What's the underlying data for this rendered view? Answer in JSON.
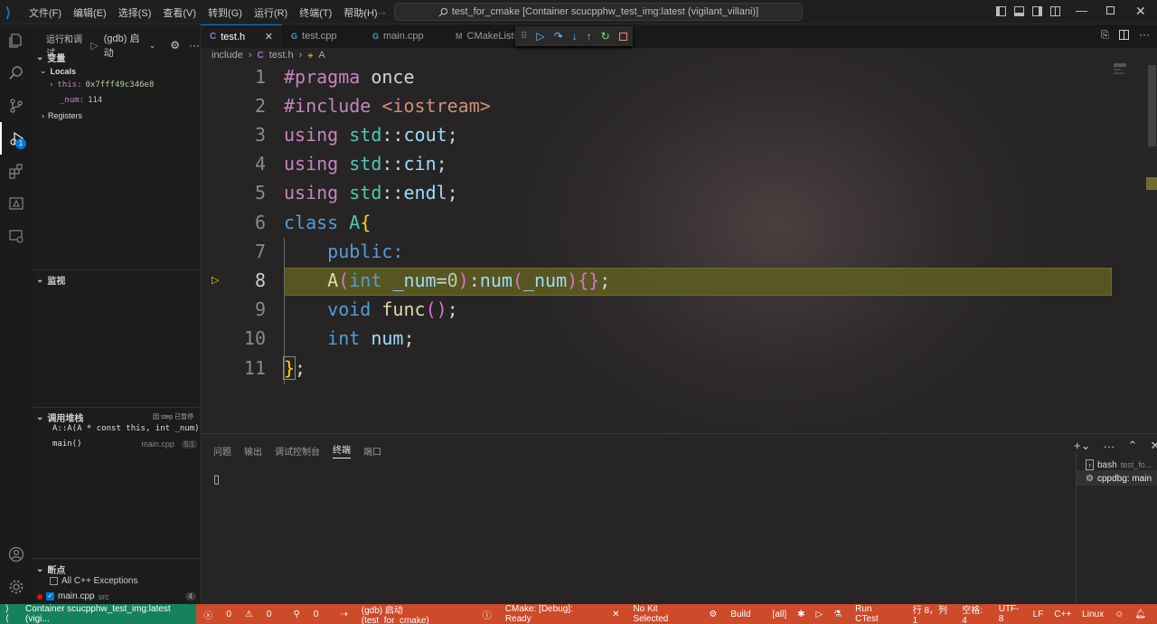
{
  "menu": [
    "文件(F)",
    "编辑(E)",
    "选择(S)",
    "查看(V)",
    "转到(G)",
    "运行(R)",
    "终端(T)",
    "帮助(H)"
  ],
  "command_center": "test_for_cmake [Container scucpphw_test_img:latest (vigilant_villani)]",
  "activity": {
    "debug_badge": "1"
  },
  "sidebar": {
    "run_title": "运行和调试",
    "config": "(gdb) 启动",
    "variables_title": "变量",
    "locals_label": "Locals",
    "var_this_name": "this:",
    "var_this_value": "0x7fff49c346e8",
    "var_num_name": "_num:",
    "var_num_value": "114",
    "registers_label": "Registers",
    "watch_title": "监视",
    "callstack_title": "调用堆栈",
    "callstack_status": "因 step 已暂停",
    "frames": [
      {
        "name": "A::A(A * const this, int _num)",
        "file": "",
        "pos": ""
      },
      {
        "name": "main()",
        "file": "main.cpp",
        "pos": "5:1"
      }
    ],
    "breakpoints_title": "断点",
    "bp1": "All C++ Exceptions",
    "bp2": "main.cpp",
    "bp2_dir": "src",
    "bp2_count": "4"
  },
  "tabs": [
    {
      "label": "test.h",
      "icon": "C"
    },
    {
      "label": "test.cpp",
      "icon": "C++"
    },
    {
      "label": "main.cpp",
      "icon": "C++"
    },
    {
      "label": "CMakeLists",
      "icon": "M"
    }
  ],
  "breadcrumb": {
    "folder": "include",
    "file": "test.h",
    "symbol": "A"
  },
  "code": {
    "line_numbers": [
      "1",
      "2",
      "3",
      "4",
      "5",
      "6",
      "7",
      "8",
      "9",
      "10",
      "11"
    ],
    "l1_kw": "#pragma",
    "l1_rest": " once",
    "l2_kw": "#include",
    "l2_str": "<iostream>",
    "using": "using",
    "std": "std",
    "sep": "::",
    "semi": ";",
    "l3_id": "cout",
    "l4_id": "cin",
    "l5_id": "endl",
    "l6_kw": "class",
    "l6_name": "A",
    "l6_brace": "{",
    "l7": "public:",
    "l8_fn": "A",
    "l8_p1": "(",
    "l8_int": "int",
    "l8_param": "_num",
    "l8_eq": "=",
    "l8_zero": "0",
    "l8_p2": ")",
    "l8_colon": ":",
    "l8_mem": "num",
    "l8_p3": "(",
    "l8_arg": "_num",
    "l8_p4": ")",
    "l8_braces": "{}",
    "l8_semi": ";",
    "l9_void": "void",
    "l9_fn": "func",
    "l9_parens": "()",
    "l9_semi": ";",
    "l10_int": "int",
    "l10_var": "num",
    "l10_semi": ";",
    "l11_brace": "}",
    "l11_semi": ";"
  },
  "panel": {
    "tabs": [
      "问题",
      "输出",
      "调试控制台",
      "终端",
      "端口"
    ],
    "active_tab": "终端",
    "terminals": [
      {
        "label": "bash",
        "detail": "test_fo..."
      },
      {
        "label": "cppdbg: main",
        "detail": ""
      }
    ],
    "prompt": "▯"
  },
  "status": {
    "remote": "Container scucpphw_test_img:latest (vigi...",
    "errors": "0",
    "warnings": "0",
    "ports": "0",
    "debug_config": "(gdb) 启动 (test_for_cmake)",
    "cmake": "CMake: [Debug]: Ready",
    "kit": "No Kit Selected",
    "build": "Build",
    "target": "[all]",
    "ctest": "Run CTest",
    "cursor": "行 8，列 1",
    "spaces": "空格: 4",
    "encoding": "UTF-8",
    "eol": "LF",
    "language": "C++",
    "os": "Linux"
  },
  "colors": {
    "status_bar": "#cd4a2a",
    "accent": "#0078d4",
    "current_line": "#5b5a23"
  }
}
